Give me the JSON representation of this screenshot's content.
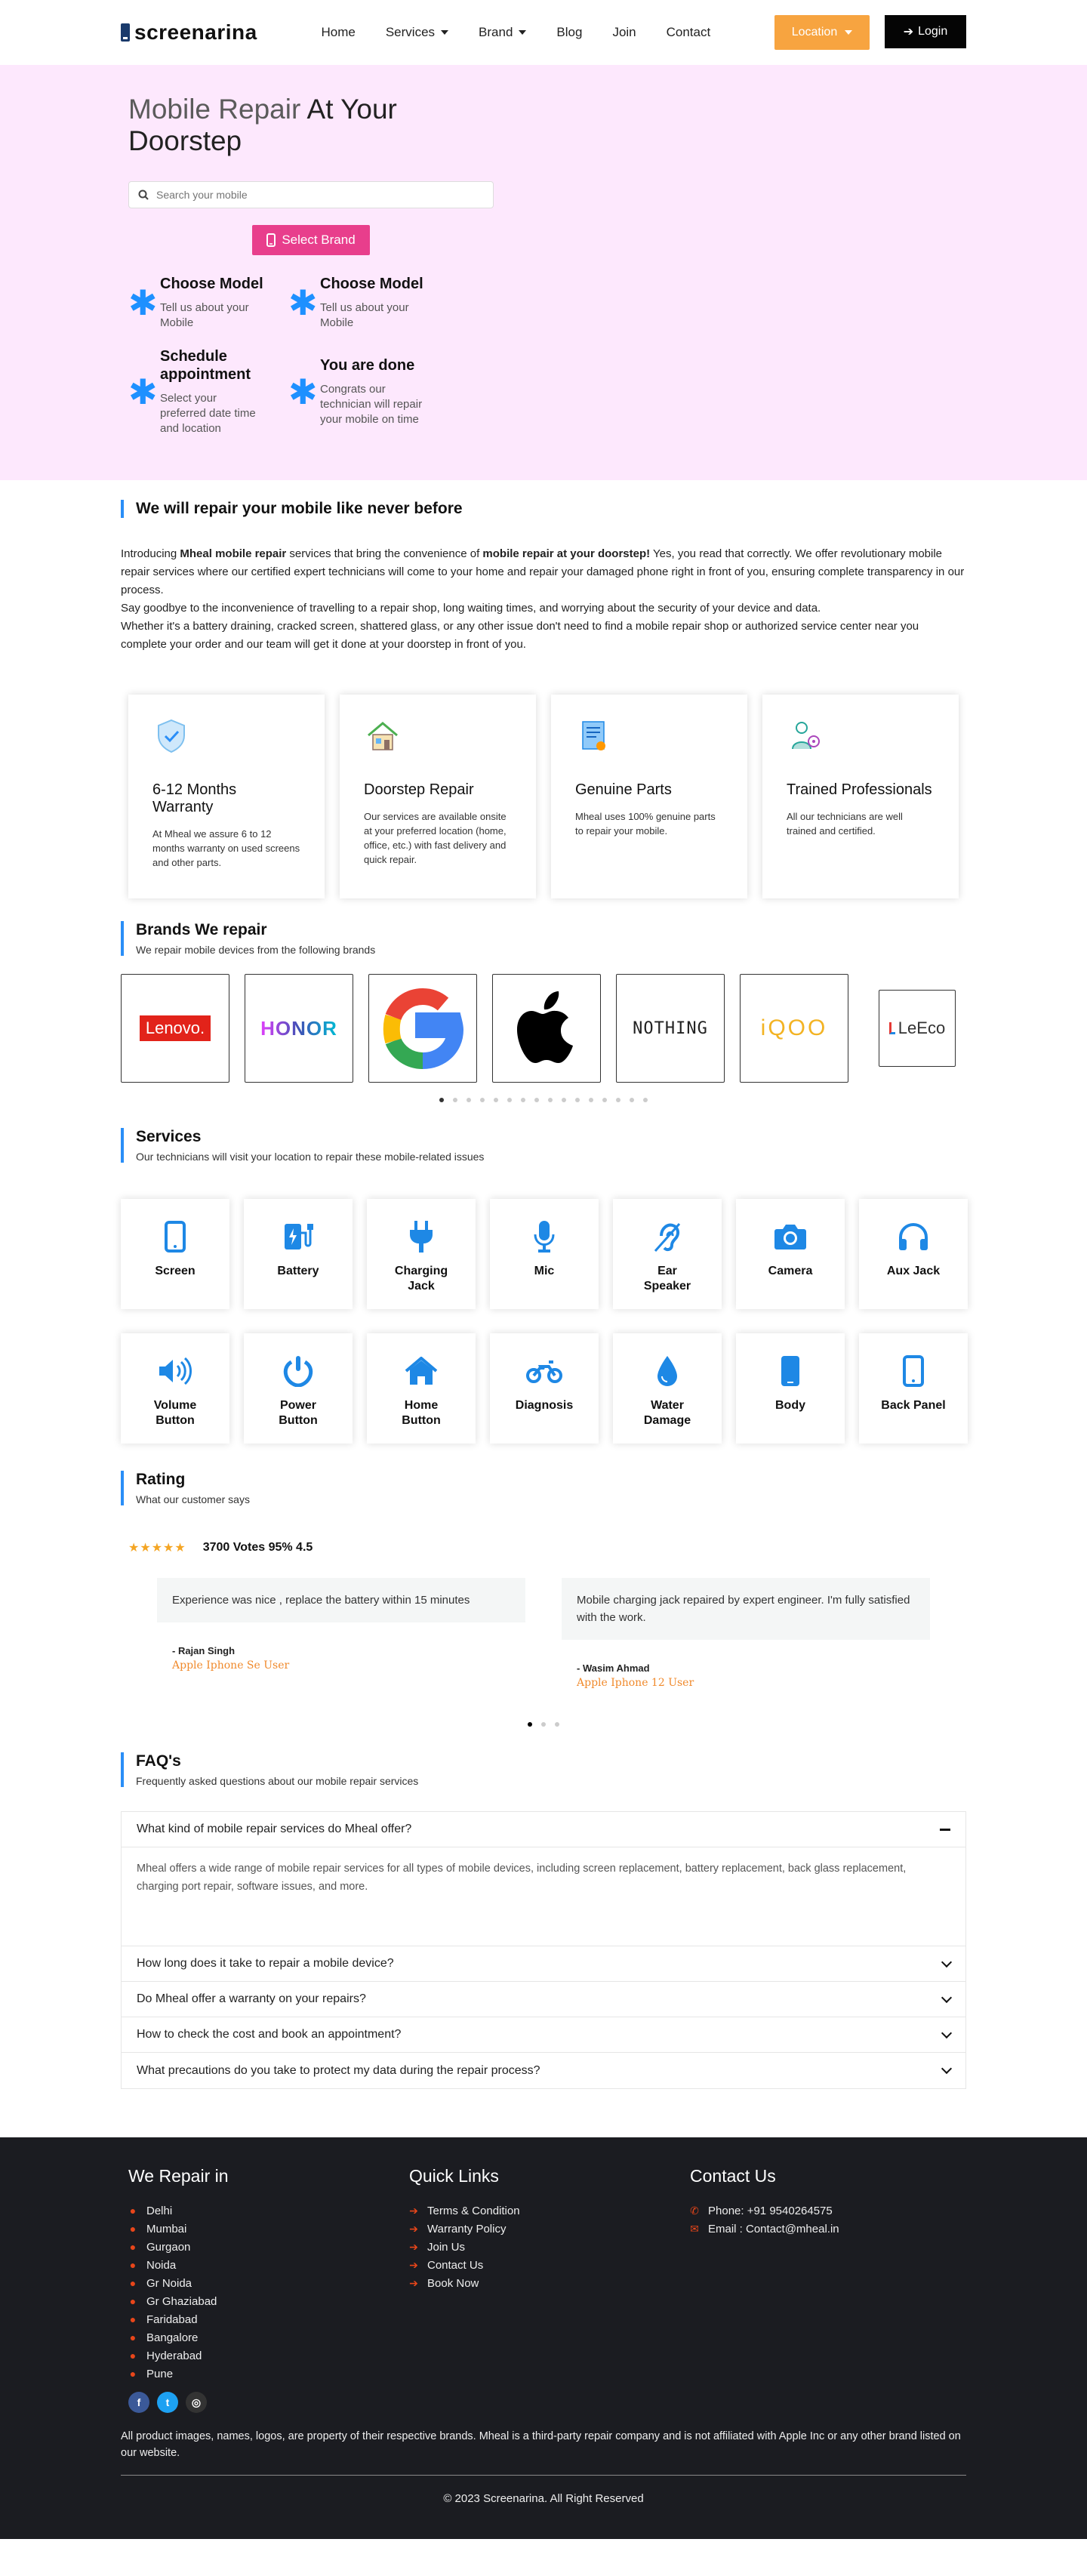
{
  "header": {
    "logo": "screenarina",
    "nav": [
      "Home",
      "Services",
      "Brand",
      "Blog",
      "Join",
      "Contact"
    ],
    "location_btn": "Location",
    "login_btn": "Login"
  },
  "hero": {
    "title_highlight": "Mobile Repair",
    "title_rest": " At Your Doorstep",
    "search_placeholder": "Search your mobile",
    "select_brand": "Select Brand",
    "steps": [
      {
        "title": "Choose Model",
        "desc": "Tell us about your Mobile"
      },
      {
        "title": "Choose Model",
        "desc": "Tell us about your Mobile"
      },
      {
        "title": "Schedule appointment",
        "desc": "Select your preferred date time and location"
      },
      {
        "title": "You are done",
        "desc": "Congrats our technician will repair your mobile on time"
      }
    ]
  },
  "intro": {
    "title": "We will repair your mobile like never before",
    "p1_a": "Introducing ",
    "p1_b": "Mheal mobile repair",
    "p1_c": " services that bring the convenience of ",
    "p1_d": "mobile repair at your doorstep!",
    "p1_e": " Yes, you read that correctly. We offer revolutionary mobile repair services where our certified expert technicians will come to your home and repair your damaged phone right in front of you, ensuring complete transparency in our process.",
    "p2": "Say goodbye to the inconvenience of travelling to a repair shop, long waiting times, and worrying about the security of your device and data.",
    "p3": "Whether it's a battery draining, cracked screen, shattered glass, or any other issue don't need to find a mobile repair shop or authorized service center near you complete your order and our team will get it done at your doorstep in front of you."
  },
  "features": [
    {
      "title": "6-12 Months Warranty",
      "desc": "At Mheal we assure 6 to 12 months warranty on used screens and other parts.",
      "icon": "shield-check-icon"
    },
    {
      "title": "Doorstep Repair",
      "desc": "Our services are available onsite at your preferred location (home, office, etc.) with fast delivery and quick repair.",
      "icon": "house-icon"
    },
    {
      "title": "Genuine Parts",
      "desc": "Mheal uses 100% genuine parts to repair your mobile.",
      "icon": "certificate-icon"
    },
    {
      "title": "Trained Professionals",
      "desc": "All our technicians are well trained and certified.",
      "icon": "technician-icon"
    }
  ],
  "brands": {
    "title": "Brands We repair",
    "subtitle": "We repair mobile devices from the following brands",
    "items": [
      "Lenovo.",
      "HONOR",
      "G",
      "Apple",
      "NOTHING",
      "iQOO",
      "LeEco"
    ]
  },
  "services": {
    "title": "Services",
    "subtitle": "Our technicians will visit your location to repair these mobile-related issues",
    "items": [
      "Screen",
      "Battery",
      "Charging Jack",
      "Mic",
      "Ear Speaker",
      "Camera",
      "Aux Jack",
      "Volume Button",
      "Power Button",
      "Home Button",
      "Diagnosis",
      "Water Damage",
      "Body",
      "Back Panel"
    ]
  },
  "rating": {
    "title": "Rating",
    "subtitle": "What our customer says",
    "stars": "★★★★★",
    "votes": "3700 Votes 95% 4.5",
    "testimonials": [
      {
        "quote": "Experience was nice , replace the battery within 15 minutes",
        "name": "- Rajan Singh",
        "role": "Apple Iphone Se User"
      },
      {
        "quote": "Mobile charging jack repaired by expert engineer. I'm fully satisfied with the work.",
        "name": "- Wasim Ahmad",
        "role": "Apple Iphone 12 User"
      }
    ]
  },
  "faq": {
    "title": "FAQ's",
    "subtitle": "Frequently asked questions about our mobile repair services",
    "items": [
      {
        "q": "What kind of mobile repair services do Mheal offer?",
        "a": "Mheal offers a wide range of mobile repair services for all types of mobile devices, including screen replacement, battery replacement, back glass replacement, charging port repair, software issues, and more."
      },
      {
        "q": "How long does it take to repair a mobile device?"
      },
      {
        "q": "Do Mheal offer a warranty on your repairs?"
      },
      {
        "q": "How to check the cost and book an appointment?"
      },
      {
        "q": "What precautions do you take to protect my data during the repair process?"
      }
    ]
  },
  "footer": {
    "col1_title": "We Repair in",
    "cities": [
      "Delhi",
      "Mumbai",
      "Gurgaon",
      "Noida",
      "Gr Noida",
      "Gr Ghaziabad",
      "Faridabad",
      "Bangalore",
      "Hyderabad",
      "Pune"
    ],
    "col2_title": "Quick Links",
    "links": [
      "Terms & Condition",
      "Warranty Policy",
      "Join Us",
      "Contact Us",
      "Book Now"
    ],
    "col3_title": "Contact Us",
    "phone": "Phone: +91 9540264575",
    "email": "Email : Contact@mheal.in",
    "disclaimer": "All product images, names, logos, are property of their respective brands. Mheal is a third-party repair company and is not affiliated with Apple Inc or any other brand listed on our website.",
    "copyright": "© 2023 Screenarina. All Right Reserved"
  },
  "colors": {
    "accent": "#2a8ef7",
    "hero_bg": "#fde8fd",
    "orange": "#f7a440",
    "pink": "#e83e8c",
    "footer_bg": "#1b1c21"
  }
}
